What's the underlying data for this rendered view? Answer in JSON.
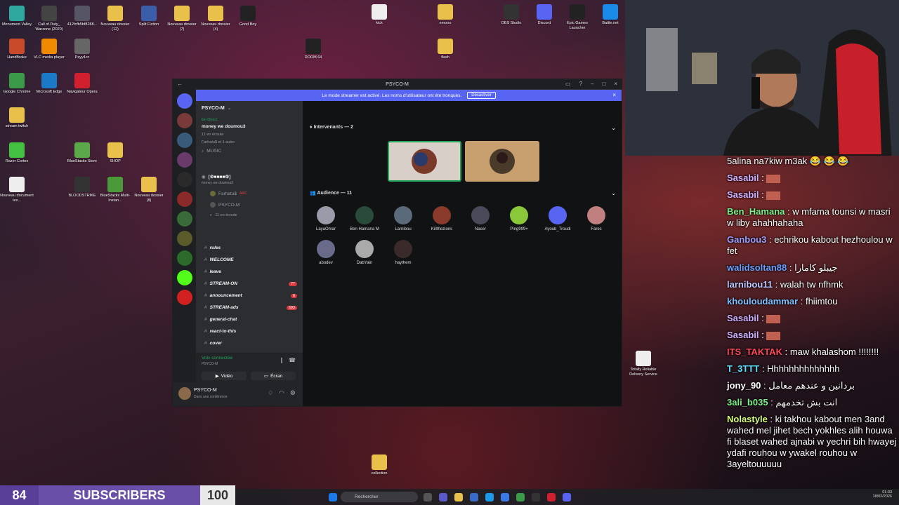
{
  "desktop_icons": [
    {
      "label": "Monument Valley",
      "color": "#2fa8a0"
    },
    {
      "label": "Call of Duty_ Warzone (2020)",
      "color": "#444"
    },
    {
      "label": "412fcfb5bf8288...",
      "color": "#556"
    },
    {
      "label": "Nouveau dossier (12)",
      "color": "#e8c04a"
    },
    {
      "label": "Split Fiction",
      "color": "#3a5ea8"
    },
    {
      "label": "Nouveau dossier (7)",
      "color": "#e8c04a"
    },
    {
      "label": "Nouveau dossier (4)",
      "color": "#e8c04a"
    },
    {
      "label": "Good Boy",
      "color": "#222"
    },
    {
      "label": "HandBrake",
      "color": "#c84a2a"
    },
    {
      "label": "VLC media player",
      "color": "#f08a00"
    },
    {
      "label": "Psyy4cc",
      "color": "#666"
    },
    {
      "label": "Google Chrome",
      "color": "#3a9a4a"
    },
    {
      "label": "Microsoft Edge",
      "color": "#1a7ac8"
    },
    {
      "label": "Navigateur Opera",
      "color": "#d02030"
    },
    {
      "label": "stream twitch",
      "color": "#e8c04a"
    },
    {
      "label": "Razer Cortex",
      "color": "#44c040"
    },
    {
      "label": "BlueStacks Store",
      "color": "#5aa84a"
    },
    {
      "label": "SHOP",
      "color": "#e8c04a"
    },
    {
      "label": "Nouveau document tex...",
      "color": "#eee"
    },
    {
      "label": "BLOODSTRIKE",
      "color": "#333"
    },
    {
      "label": "BlueStacks Multi-Instan...",
      "color": "#4a9a3a"
    },
    {
      "label": "Nouveau dossier (8)",
      "color": "#e8c04a"
    }
  ],
  "right_icons": [
    {
      "label": "kick",
      "color": "#eee"
    },
    {
      "label": "emooo",
      "color": "#e8c04a"
    },
    {
      "label": "OBS Studio",
      "color": "#333"
    },
    {
      "label": "Discord",
      "color": "#5865f2"
    },
    {
      "label": "Epic Games Launcher",
      "color": "#222"
    },
    {
      "label": "Battle.net",
      "color": "#1a8ae8"
    },
    {
      "label": "flash",
      "color": "#e8c04a"
    },
    {
      "label": "DOOM 64",
      "color": "#222"
    },
    {
      "label": "Totally Reliable Delivery Service",
      "color": "#eee"
    },
    {
      "label": "collection",
      "color": "#e8c04a"
    }
  ],
  "discord": {
    "title": "PSYCO-M",
    "banner": {
      "text": "Le mode streamer est activé. Les noms d'utilisateur ont été tronqués.",
      "button": "Désactiver"
    },
    "server_name": "PSYCO-M",
    "live": {
      "tag": "En Direct",
      "title": "money we doumou3",
      "sub": "11 en écoute",
      "people": "Farhatu$ et 1 autre"
    },
    "music": "MUSIC",
    "voice_channel": {
      "name": "[⚙■■■■⚙]",
      "sub": "money we doumou3",
      "members": [
        "Farhatu$",
        "PSYCO-M"
      ],
      "listening": "11 en écoute",
      "tag": "ARC"
    },
    "channels": [
      {
        "name": "rules",
        "badge": ""
      },
      {
        "name": "WELCOME",
        "badge": ""
      },
      {
        "name": "leave",
        "badge": ""
      },
      {
        "name": "STREAM-ON",
        "badge": "77"
      },
      {
        "name": "announcement",
        "badge": "6"
      },
      {
        "name": "STREAM-ads",
        "badge": "693"
      },
      {
        "name": "general-chat",
        "badge": ""
      },
      {
        "name": "react-to-this",
        "badge": ""
      },
      {
        "name": "cover",
        "badge": ""
      }
    ],
    "voice_status": {
      "label": "Voix connectée",
      "sub": "PSYCO-M",
      "video": "Vidéo",
      "screen": "Écran"
    },
    "user": {
      "name": "PSYCO-M",
      "status": "Dans une conférence"
    },
    "speakers_label": "Intervenants — 2",
    "audience_label": "Audience — 11",
    "audience": [
      {
        "name": "LayaOmar",
        "color": "#9a9aa8"
      },
      {
        "name": "Ben Hamana M",
        "color": "#2a4a3a"
      },
      {
        "name": "Larnibou",
        "color": "#5a6a7a"
      },
      {
        "name": "Killthezions",
        "color": "#8a3a2a"
      },
      {
        "name": "Nacer",
        "color": "#4a4a5a"
      },
      {
        "name": "Ping999+",
        "color": "#8ac83a"
      },
      {
        "name": "Ayoub_Troudi",
        "color": "#5865f2"
      },
      {
        "name": "Fares",
        "color": "#c08080"
      },
      {
        "name": "abodev",
        "color": "#6a6a8a"
      },
      {
        "name": "DabYain",
        "color": "#aaa"
      },
      {
        "name": "haythem",
        "color": "#3a2a2a"
      }
    ]
  },
  "chat": [
    {
      "user": "",
      "text": "5alina na7kiw m3ak 😂 😂 😂",
      "color": "#fff"
    },
    {
      "user": "Sasabil",
      "text": "",
      "color": "#d0b0ff"
    },
    {
      "user": "Sasabil",
      "text": "",
      "color": "#d0b0ff"
    },
    {
      "user": "Ben_Hamana",
      "text": "w mfama tounsi w masri w liby ahahhahaha",
      "color": "#7ef08a"
    },
    {
      "user": "Ganbou3",
      "text": "echrikou kabout hezhoulou w fet",
      "color": "#a0a0ff"
    },
    {
      "user": "walidsoltan88",
      "text": "جيبلو كامارا",
      "color": "#6aa0ff"
    },
    {
      "user": "larnibou11",
      "text": "walah tw nfhmk",
      "color": "#c0c8ff"
    },
    {
      "user": "khouloudammar",
      "text": "fhiimtou",
      "color": "#80c0ff"
    },
    {
      "user": "Sasabil",
      "text": "",
      "color": "#d0b0ff"
    },
    {
      "user": "Sasabil",
      "text": "",
      "color": "#d0b0ff"
    },
    {
      "user": "ITS_TAKTAK",
      "text": "maw khalashom !!!!!!!!",
      "color": "#ff4a5a"
    },
    {
      "user": "T_3TTT",
      "text": "Hhhhhhhhhhhhhh",
      "color": "#60e0ff"
    },
    {
      "user": "jony_90",
      "text": "بردانين و عندهم معامل",
      "color": "#fff"
    },
    {
      "user": "3ali_b035",
      "text": "انت بش تخدمهم",
      "color": "#7ef08a"
    },
    {
      "user": "Nolastyle",
      "text": "ki takhou kabout men 3and wahed mel jihet bech yokhles alih houwa fi blaset wahed ajnabi w yechri bih hwayej ydafi rouhou w ywakel rouhou w 3ayeltouuuuu",
      "color": "#d8ff7a"
    }
  ],
  "subscribers": {
    "current": "84",
    "label": "SUBSCRIBERS",
    "goal": "100"
  },
  "taskbar": {
    "search": "Rechercher",
    "time": "01:33",
    "date": "18/02/2026"
  }
}
